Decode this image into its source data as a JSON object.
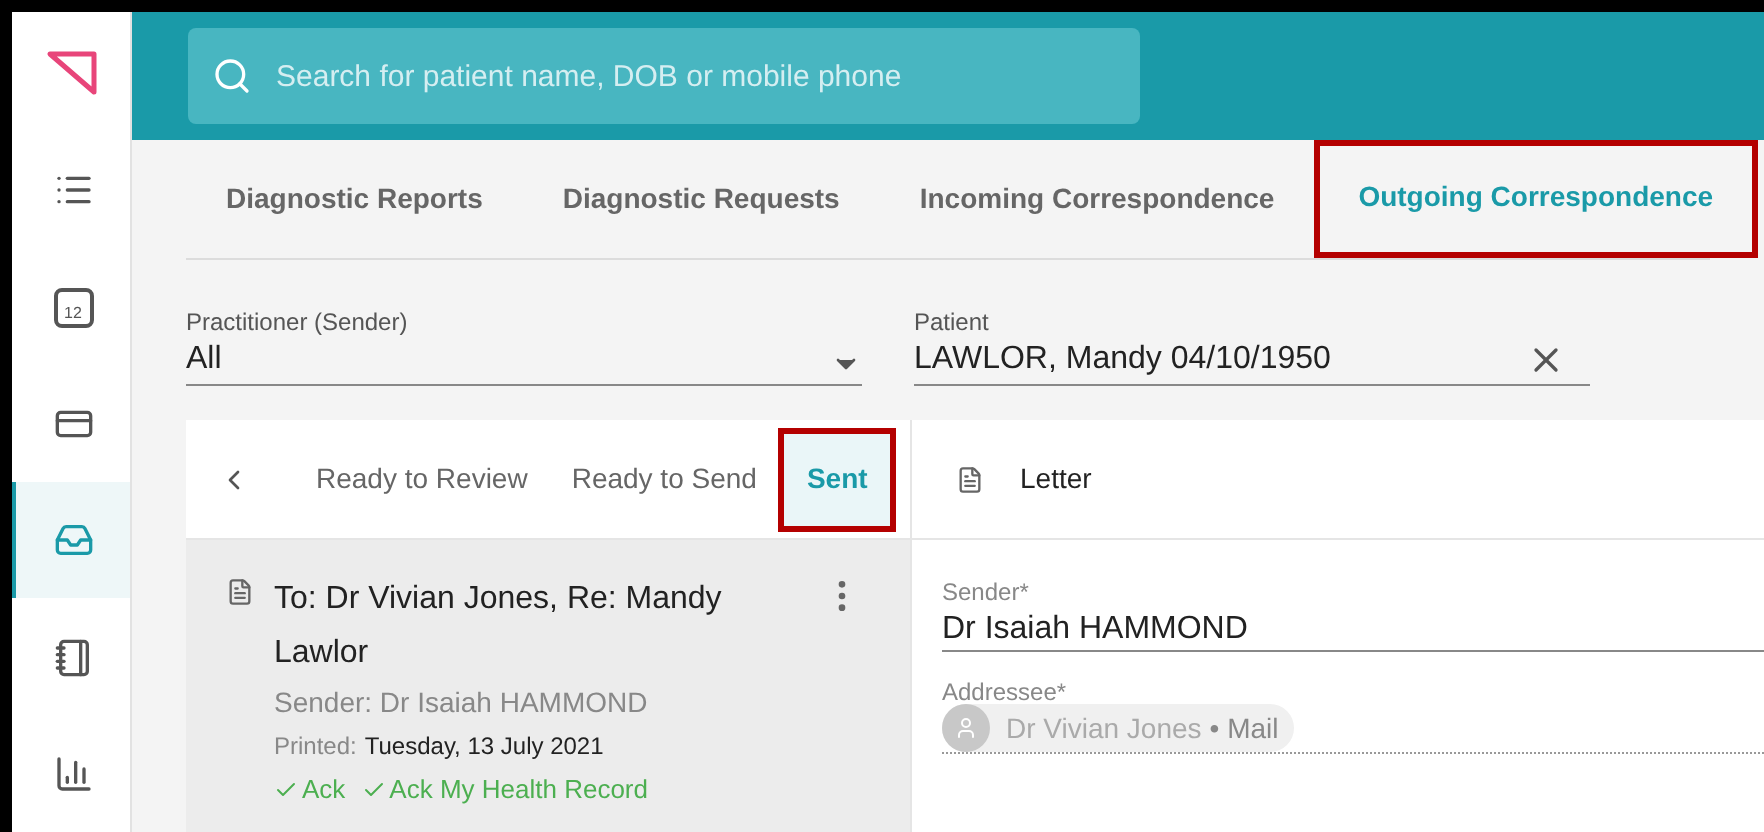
{
  "sidebar": {
    "items": [
      {
        "kind": "list",
        "selected": false
      },
      {
        "kind": "calendar",
        "label": "12",
        "selected": false
      },
      {
        "kind": "card",
        "selected": false
      },
      {
        "kind": "inbox",
        "selected": true
      },
      {
        "kind": "notebook",
        "selected": false
      },
      {
        "kind": "chart",
        "selected": false
      }
    ]
  },
  "search": {
    "placeholder": "Search for patient name, DOB or mobile phone"
  },
  "tabs": [
    {
      "label": "Diagnostic Reports",
      "selected": false,
      "highlighted": false
    },
    {
      "label": "Diagnostic Requests",
      "selected": false,
      "highlighted": false
    },
    {
      "label": "Incoming Correspondence",
      "selected": false,
      "highlighted": false
    },
    {
      "label": "Outgoing Correspondence",
      "selected": true,
      "highlighted": true
    }
  ],
  "filters": {
    "practitioner": {
      "label": "Practitioner (Sender)",
      "value": "All"
    },
    "patient": {
      "label": "Patient",
      "value": "LAWLOR, Mandy 04/10/1950"
    }
  },
  "status_tabs": [
    {
      "label": "Ready to Review",
      "selected": false,
      "highlighted": false
    },
    {
      "label": "Ready to Send",
      "selected": false,
      "highlighted": false
    },
    {
      "label": "Sent",
      "selected": true,
      "highlighted": true
    }
  ],
  "letters": [
    {
      "title": "To: Dr Vivian Jones, Re: Mandy Lawlor",
      "sender": "Sender: Dr Isaiah HAMMOND",
      "printed_label": "Printed:",
      "printed_date": "Tuesday, 13 July 2021",
      "acks": [
        "Ack",
        "Ack My Health Record"
      ]
    }
  ],
  "detail": {
    "title": "Letter",
    "sender": {
      "label": "Sender*",
      "value": "Dr Isaiah HAMMOND"
    },
    "addressee": {
      "label": "Addressee*",
      "name": "Dr Vivian Jones",
      "method": "• Mail"
    }
  }
}
